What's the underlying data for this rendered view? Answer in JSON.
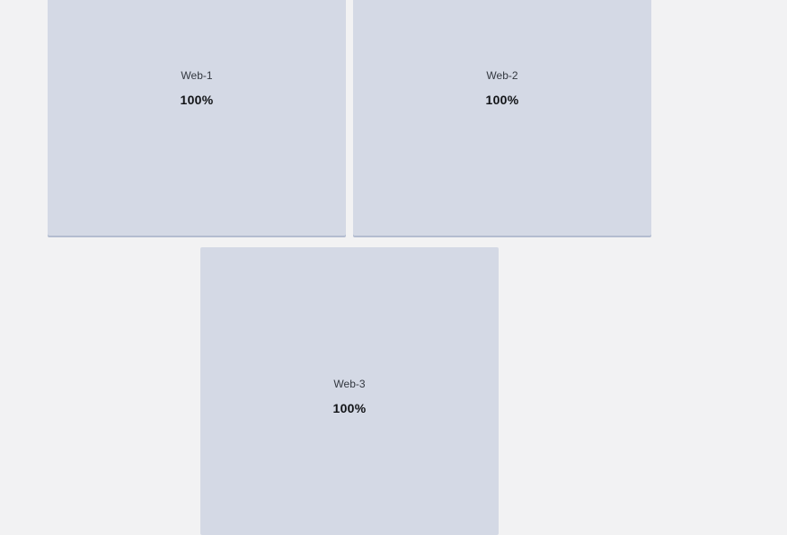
{
  "servers": [
    {
      "name": "Web-1",
      "value": "100%"
    },
    {
      "name": "Web-2",
      "value": "100%"
    },
    {
      "name": "Web-3",
      "value": "100%"
    }
  ]
}
